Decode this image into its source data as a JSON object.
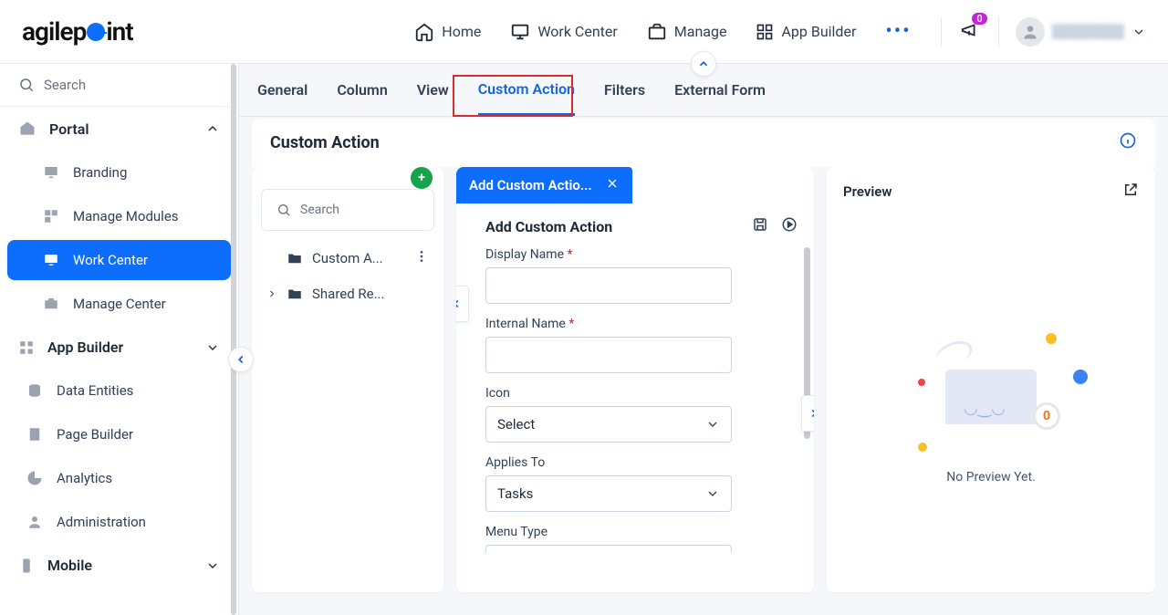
{
  "topnav": {
    "home": "Home",
    "workcenter": "Work Center",
    "manage": "Manage",
    "appbuilder": "App Builder",
    "notif_count": "0"
  },
  "sidebar": {
    "search_placeholder": "Search",
    "portal": "Portal",
    "branding": "Branding",
    "manage_modules": "Manage Modules",
    "work_center": "Work Center",
    "manage_center": "Manage Center",
    "app_builder": "App Builder",
    "data_entities": "Data Entities",
    "page_builder": "Page Builder",
    "analytics": "Analytics",
    "administration": "Administration",
    "mobile": "Mobile"
  },
  "tabs": {
    "general": "General",
    "column": "Column",
    "view": "View",
    "custom_action": "Custom Action",
    "filters": "Filters",
    "external_form": "External Form"
  },
  "panel_title": "Custom Action",
  "list": {
    "search_placeholder": "Search",
    "item1": "Custom A...",
    "item2": "Shared Re..."
  },
  "form": {
    "tab_label": "Add Custom Actio...",
    "heading": "Add Custom Action",
    "display_name_label": "Display Name",
    "internal_name_label": "Internal Name",
    "icon_label": "Icon",
    "icon_value": "Select",
    "applies_to_label": "Applies To",
    "applies_to_value": "Tasks",
    "menu_type_label": "Menu Type"
  },
  "preview": {
    "title": "Preview",
    "empty": "No Preview Yet.",
    "doc_badge": "0"
  }
}
